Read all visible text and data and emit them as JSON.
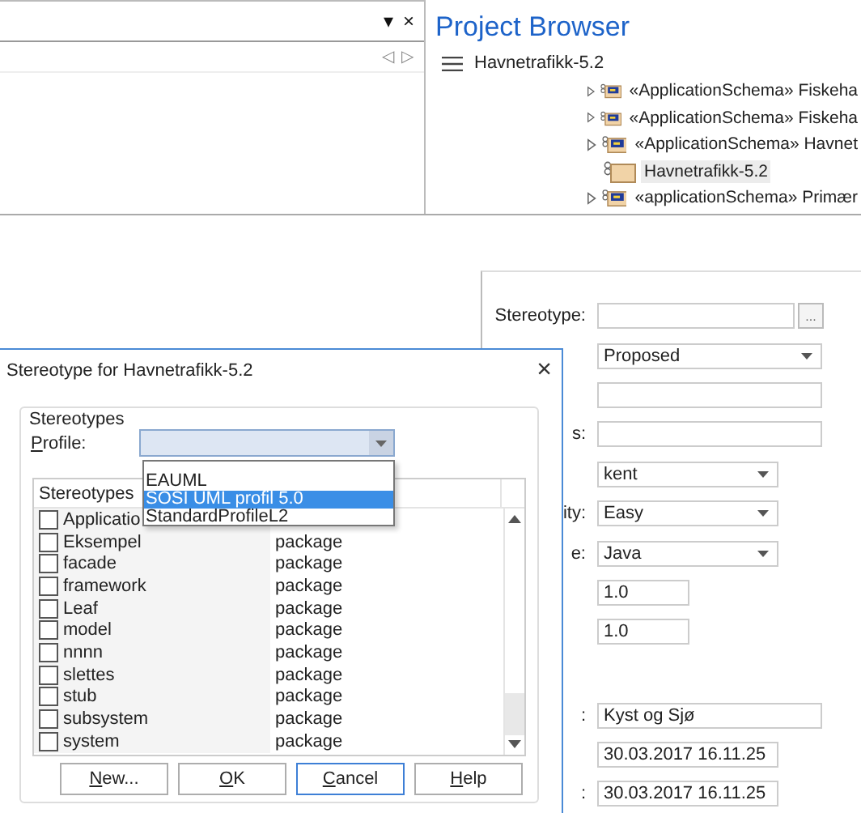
{
  "top_panel": {
    "menu_glyph": "▾",
    "close_glyph": "×",
    "prev_glyph": "◁",
    "next_glyph": "▷"
  },
  "project_browser": {
    "title": "Project Browser",
    "root": "Havnetrafikk-5.2",
    "items": [
      {
        "label": "«ApplicationSchema» Fiskeha",
        "kind": "schema",
        "expandable": true,
        "selected": false
      },
      {
        "label": "«ApplicationSchema» Fiskeha",
        "kind": "schema",
        "expandable": true,
        "selected": false
      },
      {
        "label": "«ApplicationSchema» Havnet",
        "kind": "schema",
        "expandable": true,
        "selected": false
      },
      {
        "label": "Havnetrafikk-5.2",
        "kind": "folder",
        "expandable": false,
        "selected": true
      },
      {
        "label": "«applicationSchema» Primær",
        "kind": "schema",
        "expandable": true,
        "selected": false
      }
    ]
  },
  "properties": {
    "rows": [
      {
        "label": "Stereotype:",
        "kind": "browse",
        "button": "..."
      },
      {
        "kind": "dropdown",
        "value": "Proposed"
      },
      {
        "kind": "text"
      },
      {
        "label": "s:",
        "kind": "text"
      },
      {
        "kind": "short-dropdown",
        "value": "kent"
      },
      {
        "label": "ity:",
        "kind": "short-dropdown",
        "value": "Easy"
      },
      {
        "label": "e:",
        "kind": "short-dropdown",
        "value": "Java"
      },
      {
        "kind": "short-text",
        "value": "1.0"
      },
      {
        "kind": "short-text",
        "value": "1.0"
      }
    ],
    "history_rows": [
      {
        "label": ":",
        "kind": "text",
        "value": "Kyst og Sjø"
      },
      {
        "kind": "date",
        "value": "30.03.2017 16.11.25"
      },
      {
        "label": ":",
        "kind": "date",
        "value": "30.03.2017 16.11.25"
      }
    ]
  },
  "dialog": {
    "title": "Stereotype for Havnetrafikk-5.2",
    "close_glyph": "×",
    "group_label": "Stereotypes",
    "profile_label": "Profile:",
    "profile_dropdown": {
      "expanded": true,
      "options": [
        {
          "label": "EAUML",
          "selected": false
        },
        {
          "label": "SOSI UML profil 5.0",
          "selected": true
        },
        {
          "label": "StandardProfileL2",
          "selected": false
        }
      ]
    },
    "list": {
      "columns": [
        "Stereotypes"
      ],
      "rows": [
        {
          "name": "Applicatio",
          "checked": false
        },
        {
          "name": "Eksempel",
          "type": "package",
          "checked": false
        },
        {
          "name": "facade",
          "type": "package",
          "checked": false
        },
        {
          "name": "framework",
          "type": "package",
          "checked": false
        },
        {
          "name": "Leaf",
          "type": "package",
          "checked": false
        },
        {
          "name": "model",
          "type": "package",
          "checked": false
        },
        {
          "name": "nnnn",
          "type": "package",
          "checked": false
        },
        {
          "name": "slettes",
          "type": "package",
          "checked": false
        },
        {
          "name": "stub",
          "type": "package",
          "checked": false
        },
        {
          "name": "subsystem",
          "type": "package",
          "checked": false
        },
        {
          "name": "system",
          "type": "package",
          "checked": false
        }
      ]
    },
    "buttons": [
      {
        "label": "New...",
        "focused": false
      },
      {
        "label": "OK",
        "focused": false
      },
      {
        "label": "Cancel",
        "focused": true
      },
      {
        "label": "Help",
        "focused": false
      }
    ]
  }
}
